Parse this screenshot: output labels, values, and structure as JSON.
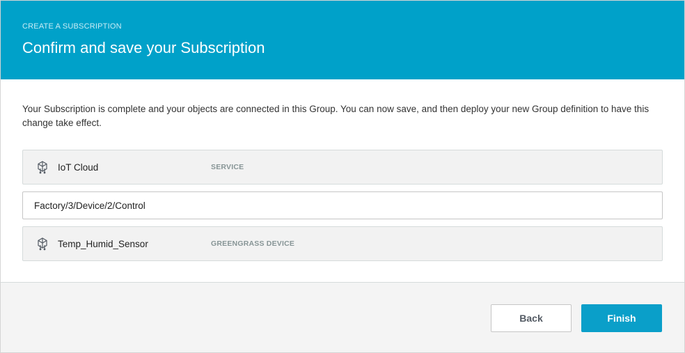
{
  "header": {
    "eyebrow": "CREATE A SUBSCRIPTION",
    "title": "Confirm and save your Subscription"
  },
  "description": "Your Subscription is complete and your objects are connected in this Group. You can now save, and then deploy your new Group definition to have this change take effect.",
  "source": {
    "name": "IoT Cloud",
    "type": "SERVICE",
    "icon": "iot-thing-icon"
  },
  "topic": {
    "value": "Factory/3/Device/2/Control"
  },
  "target": {
    "name": "Temp_Humid_Sensor",
    "type": "GREENGRASS DEVICE",
    "icon": "iot-thing-icon"
  },
  "footer": {
    "back_label": "Back",
    "finish_label": "Finish"
  },
  "colors": {
    "header_bg": "#00a1c9",
    "primary_button": "#0a9fc9"
  }
}
